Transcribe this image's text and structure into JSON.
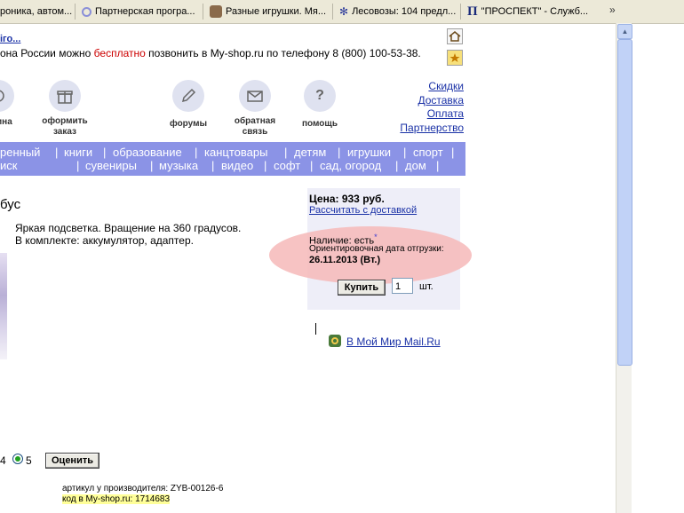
{
  "bookmarks": [
    {
      "label": "роника, автом...",
      "icon": "globe-icon"
    },
    {
      "label": "Партнерская програ...",
      "icon": "circle-icon"
    },
    {
      "label": "Разные игрушки. Мя...",
      "icon": "toy-icon"
    },
    {
      "label": "Лесовозы: 104 предл...",
      "icon": "gear-icon"
    },
    {
      "label": "\"ПРОСПЕКТ\" - Служб...",
      "icon": "pi-icon"
    }
  ],
  "header": {
    "title_fragment": "іго...",
    "phone_prefix": "она России можно ",
    "phone_free": "бесплатно",
    "phone_suffix": " позвонить в My-shop.ru по телефону 8 (800) 100-53-38."
  },
  "toolbar": {
    "cart_label": "ина",
    "order_label_1": "оформить",
    "order_label_2": "заказ",
    "forums_label": "форумы",
    "feedback_label_1": "обратная",
    "feedback_label_2": "связь",
    "help_label": "помощь",
    "help_glyph": "?"
  },
  "side_links": [
    "Скидки",
    "Доставка",
    "Оплата",
    "Партнерство"
  ],
  "nav": {
    "left_1": "ренный",
    "left_2": "иск",
    "row1": [
      "книги",
      "образование",
      "канцтовары",
      "детям",
      "игрушки",
      "спорт"
    ],
    "row2": [
      "сувениры",
      "музыка",
      "видео",
      "софт",
      "сад, огород",
      "дом"
    ]
  },
  "product": {
    "title_fragment": "бус",
    "desc_line1": "Яркая подсветка. Вращение на 360 градусов.",
    "desc_line2": "В комплекте: аккумулятор, адаптер."
  },
  "price_box": {
    "price": "Цена: 933 руб.",
    "calc_link": "Рассчитать с доставкой",
    "availability": "Наличие: есть",
    "asterisk": "*",
    "ship_label": "Ориентировочная дата отгрузки:",
    "ship_date": "26.11.2013 (Вт.)",
    "buy_button": "Купить",
    "qty": "1",
    "unit": "шт."
  },
  "social": {
    "moimir_link": "В Мой Мир Mail.Ru"
  },
  "rating": {
    "prev_value": "4",
    "selected_value": "5",
    "rate_button": "Оценить"
  },
  "article": {
    "manufacturer": "артикул у производителя: ZYB-00126-6",
    "shop_code": "код в My-shop.ru: 1714683"
  },
  "colors": {
    "nav_bg": "#8b93e6",
    "link": "#1a31a6",
    "free_text": "#cc0000",
    "highlight": "#ffff99",
    "price_box_bg": "#eeeef8",
    "ellipse": "#f6b9b9"
  }
}
